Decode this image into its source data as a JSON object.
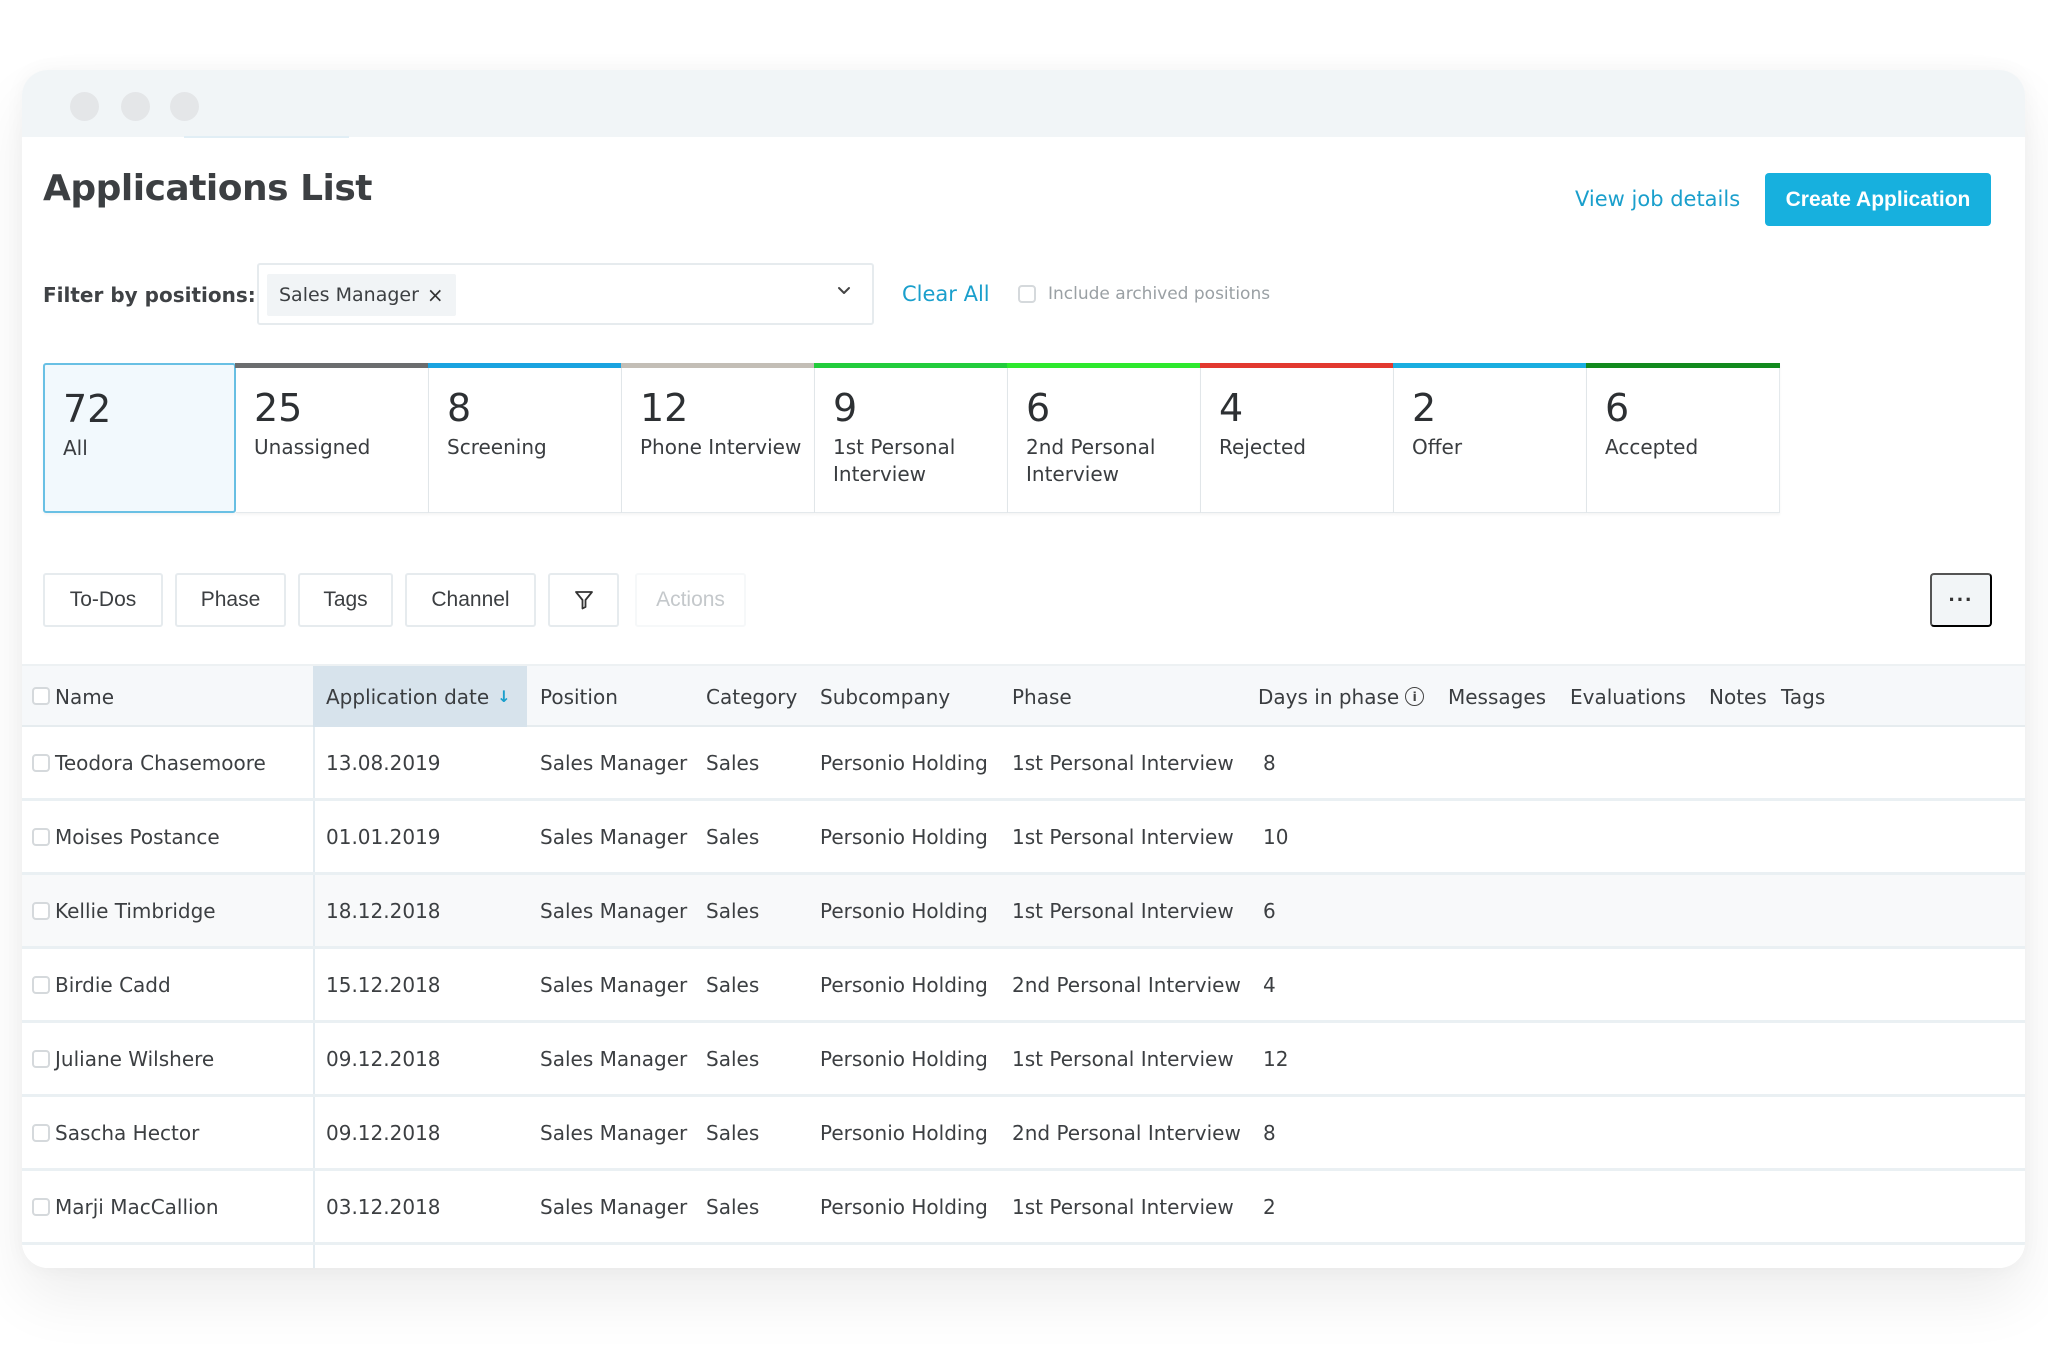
{
  "window": {
    "controls": [
      "close",
      "minimize",
      "maximize"
    ]
  },
  "header": {
    "title": "Applications List",
    "view_job_link": "View job details",
    "create_button": "Create Application"
  },
  "filter": {
    "label": "Filter by positions:",
    "selected_chip": "Sales Manager",
    "chip_remove_icon": "×",
    "clear_all": "Clear All",
    "include_archived_label": "Include archived positions",
    "include_archived_checked": false
  },
  "phase_cards": [
    {
      "count": "72",
      "label": "All",
      "color": "",
      "selected": true
    },
    {
      "count": "25",
      "label": "Unassigned",
      "color": "#6b6d6f",
      "selected": false
    },
    {
      "count": "8",
      "label": "Screening",
      "color": "#1aa3e0",
      "selected": false
    },
    {
      "count": "12",
      "label": "Phone Interview",
      "color": "#c3beb6",
      "selected": false
    },
    {
      "count": "9",
      "label": "1st Personal Interview",
      "color": "#22cc3c",
      "selected": false
    },
    {
      "count": "6",
      "label": "2nd Personal Interview",
      "color": "#2ee82e",
      "selected": false
    },
    {
      "count": "4",
      "label": "Rejected",
      "color": "#e2392f",
      "selected": false
    },
    {
      "count": "2",
      "label": "Offer",
      "color": "#1aaee0",
      "selected": false
    },
    {
      "count": "6",
      "label": "Accepted",
      "color": "#128a1e",
      "selected": false
    }
  ],
  "toolbar": {
    "todos": "To-Dos",
    "phase": "Phase",
    "tags": "Tags",
    "channel": "Channel",
    "filter_icon": "filter-icon",
    "actions": "Actions",
    "more": "···"
  },
  "table": {
    "columns": {
      "name": "Name",
      "application_date": "Application date",
      "sort_indicator": "↓",
      "position": "Position",
      "category": "Category",
      "subcompany": "Subcompany",
      "phase": "Phase",
      "days_in_phase": "Days in phase",
      "info_icon": "i",
      "messages": "Messages",
      "evaluations": "Evaluations",
      "notes": "Notes",
      "tags": "Tags"
    },
    "rows": [
      {
        "name": "Teodora Chasemoore",
        "date": "13.08.2019",
        "position": "Sales Manager",
        "category": "Sales",
        "subcompany": "Personio Holding",
        "phase": "1st Personal Interview",
        "days": "8"
      },
      {
        "name": "Moises Postance",
        "date": "01.01.2019",
        "position": "Sales Manager",
        "category": "Sales",
        "subcompany": "Personio Holding",
        "phase": "1st Personal Interview",
        "days": "10"
      },
      {
        "name": "Kellie Timbridge",
        "date": "18.12.2018",
        "position": "Sales Manager",
        "category": "Sales",
        "subcompany": "Personio Holding",
        "phase": "1st Personal Interview",
        "days": "6"
      },
      {
        "name": "Birdie Cadd",
        "date": "15.12.2018",
        "position": "Sales Manager",
        "category": "Sales",
        "subcompany": "Personio Holding",
        "phase": "2nd Personal Interview",
        "days": "4"
      },
      {
        "name": "Juliane Wilshere",
        "date": "09.12.2018",
        "position": "Sales Manager",
        "category": "Sales",
        "subcompany": "Personio Holding",
        "phase": "1st Personal Interview",
        "days": "12"
      },
      {
        "name": "Sascha Hector",
        "date": "09.12.2018",
        "position": "Sales Manager",
        "category": "Sales",
        "subcompany": "Personio Holding",
        "phase": "2nd Personal Interview",
        "days": "8"
      },
      {
        "name": "Marji MacCallion",
        "date": "03.12.2018",
        "position": "Sales Manager",
        "category": "Sales",
        "subcompany": "Personio Holding",
        "phase": "1st Personal Interview",
        "days": "2"
      }
    ]
  },
  "colors": {
    "accent": "#17b0de",
    "link": "#1a9fcc",
    "selected_card_border": "#69c0e4",
    "sorted_column_bg": "#d7e3ec"
  }
}
